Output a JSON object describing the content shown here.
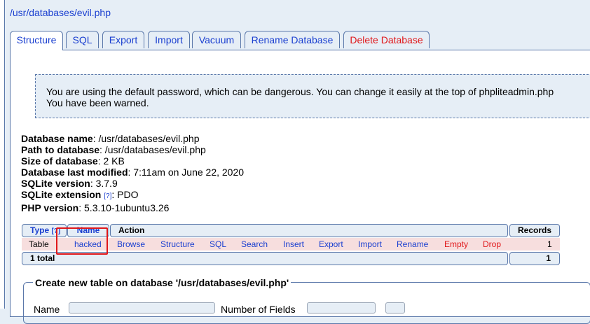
{
  "breadcrumb": "/usr/databases/evil.php",
  "tabs": [
    "Structure",
    "SQL",
    "Export",
    "Import",
    "Vacuum",
    "Rename Database",
    "Delete Database"
  ],
  "warning": {
    "line1": "You are using the default password, which can be dangerous. You can change it easily at the top of phpliteadmin.php",
    "line2": "You have been warned."
  },
  "info": {
    "db_name_label": "Database name",
    "db_name_value": ": /usr/databases/evil.php",
    "path_label": "Path to database",
    "path_value": ": /usr/databases/evil.php",
    "size_label": "Size of database",
    "size_value": ": 2 KB",
    "modified_label": "Database last modified",
    "modified_value": ": 7:11am on June 22, 2020",
    "sqlite_version_label": "SQLite version",
    "sqlite_version_value": ": 3.7.9",
    "sqlite_ext_label": "SQLite extension",
    "sqlite_ext_help": "[?]",
    "sqlite_ext_value": ": PDO",
    "php_version_label": "PHP version",
    "php_version_value": ": 5.3.10-1ubuntu3.26"
  },
  "table": {
    "headers": {
      "type": "Type",
      "type_help": "[?]",
      "name": "Name",
      "action": "Action",
      "records": "Records"
    },
    "row": {
      "type": "Table",
      "name": "hacked",
      "actions": [
        "Browse",
        "Structure",
        "SQL",
        "Search",
        "Insert",
        "Export",
        "Import",
        "Rename",
        "Empty",
        "Drop"
      ],
      "records": "1"
    },
    "total_label": "1 total",
    "total_records": "1"
  },
  "create": {
    "legend": "Create new table on database '/usr/databases/evil.php'",
    "name_label": "Name",
    "fields_label": "Number of Fields"
  },
  "colors": {
    "accent": "#1a3fd0",
    "danger": "#e0171a",
    "panel_bg": "#e6eef6",
    "border": "#5a78aa",
    "highlight": "#e0171a"
  }
}
